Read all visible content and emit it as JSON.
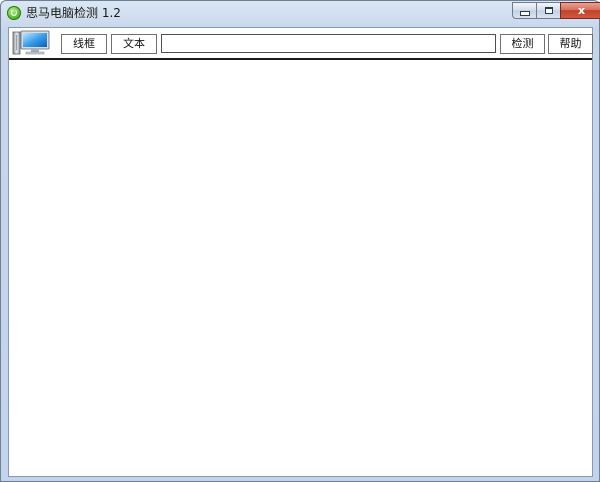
{
  "window": {
    "title": "思马电脑检测 1.2",
    "icons": {
      "app": "app-logo-icon",
      "minimize": "minimize-icon",
      "maximize": "maximize-icon",
      "close": "close-icon"
    },
    "close_glyph": "x"
  },
  "toolbar": {
    "monitor_icon": "monitor-icon",
    "wireframe_label": "线框",
    "text_label": "文本",
    "address_value": "",
    "detect_label": "检测",
    "help_label": "帮助"
  },
  "colors": {
    "frame": "#c2d4eb",
    "close_button": "#c1412a",
    "content": "#ffffff"
  }
}
